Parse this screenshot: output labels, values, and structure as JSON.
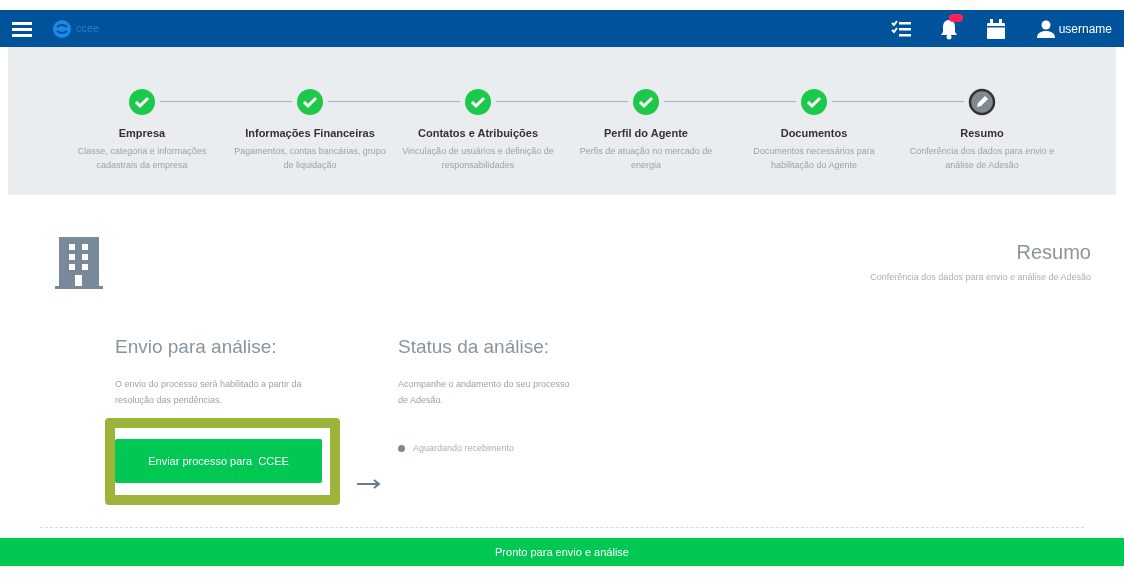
{
  "navbar": {
    "logo": "ccee",
    "user": "username",
    "notifications_badge": true
  },
  "steps": [
    {
      "title": "Empresa",
      "description": "Classe, categoria e informações cadastrais da empresa",
      "done": true
    },
    {
      "title": "Informações Financeiras",
      "description": "Pagamentos, contas bancárias, grupo de liquidação",
      "done": true
    },
    {
      "title": "Contatos e Atribuições",
      "description": "Vinculação de usuários e definição de responsabilidades",
      "done": true
    },
    {
      "title": "Perfil do Agente",
      "description": "Perfis de atuação no mercado de energia",
      "done": true
    },
    {
      "title": "Documentos",
      "description": "Documentos necessários para habilitação do Agente",
      "done": true
    },
    {
      "title": "Resumo",
      "description": "Conferência dos dados para envio e análise de Adesão",
      "done": false
    }
  ],
  "page": {
    "title": "Resumo",
    "subtitle": "Conferência dos dados para envio e análise de Adesão"
  },
  "send": {
    "heading": "Envio para análise:",
    "text": "O envio do processo será habilitado a partir da resolução das pendências.",
    "button": "Enviar processo para  CCEE",
    "highlighted": true
  },
  "status": {
    "heading": "Status da análise:",
    "text": "Acompanhe o andamento do seu processo de Adesão.",
    "item": "Aguardando recebimento"
  },
  "footer_bar": "Pronto para envio e análise"
}
